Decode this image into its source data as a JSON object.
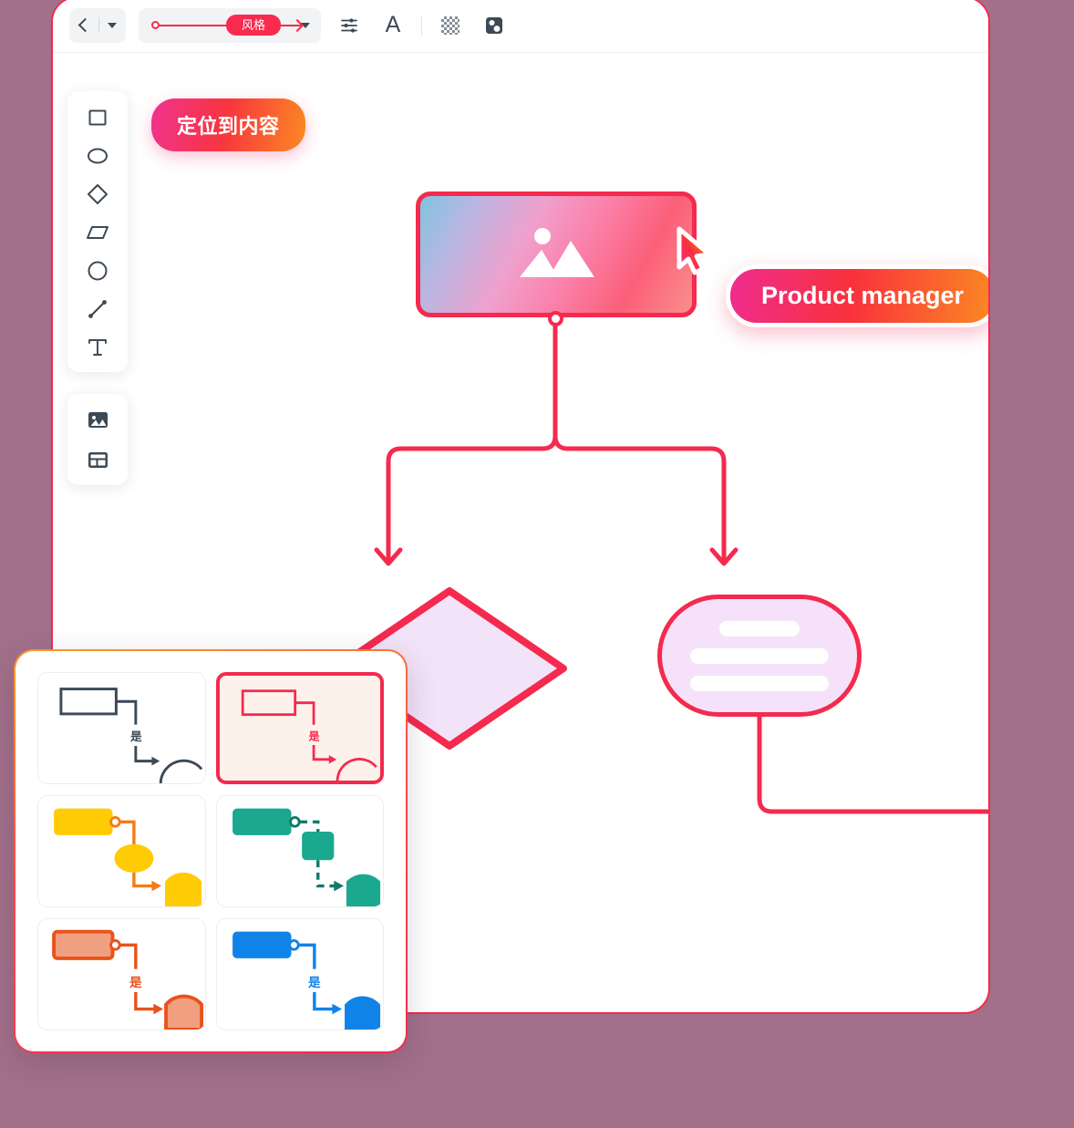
{
  "app": {
    "background_color": "#a2708a",
    "window_border_color": "#f42a4e",
    "accent_color": "#f42a4e"
  },
  "toolbar": {
    "back_button": {
      "name": "back",
      "icon": "chevron-left-icon"
    },
    "back_dropdown": {
      "icon": "caret-down-icon"
    },
    "style_selector": {
      "label": "风格",
      "icon": "connector-style-icon",
      "dropdown_icon": "caret-down-icon"
    },
    "icons": [
      {
        "name": "properties-sliders-icon",
        "label": "属性"
      },
      {
        "name": "font-icon",
        "label": "A"
      },
      {
        "name": "transparency-checker-icon",
        "label": "透明度"
      },
      {
        "name": "fill-shape-icon",
        "label": "填充"
      }
    ]
  },
  "shape_rail": {
    "tools": [
      {
        "name": "rectangle-tool",
        "icon": "square-icon"
      },
      {
        "name": "ellipse-tool",
        "icon": "ellipse-icon"
      },
      {
        "name": "diamond-tool",
        "icon": "diamond-icon"
      },
      {
        "name": "parallelogram-tool",
        "icon": "parallelogram-icon"
      },
      {
        "name": "circle-tool",
        "icon": "circle-icon"
      },
      {
        "name": "line-tool",
        "icon": "line-icon"
      },
      {
        "name": "text-tool",
        "icon": "text-t-icon"
      }
    ]
  },
  "media_rail": {
    "tools": [
      {
        "name": "image-tool",
        "icon": "image-icon"
      },
      {
        "name": "layout-tool",
        "icon": "layout-grid-icon"
      }
    ]
  },
  "canvas": {
    "locate_badge": {
      "label": "定位到内容",
      "gradient_from": "#f0338f",
      "gradient_to": "#fb8a21"
    },
    "role_tag": {
      "label": "Product manager",
      "gradient_from": "#ef2d90",
      "gradient_to": "#fb8a22"
    },
    "image_node": {
      "icon": "image-placeholder-icon",
      "border_color": "#f42a4e"
    },
    "cursor": {
      "icon": "mouse-cursor-icon"
    },
    "node_anchor": {
      "icon": "connection-anchor-icon"
    },
    "diamond_node": {
      "fill": "#f2e3f8",
      "stroke": "#f42a4e"
    },
    "pill_node": {
      "fill": "#f5e2fa",
      "stroke": "#f42a4e",
      "bars": [
        "short",
        "long",
        "long"
      ]
    }
  },
  "style_panel": {
    "swatches": [
      {
        "name": "style-gray",
        "selected": false,
        "stroke": "#3c4956",
        "fill": "none",
        "line": "#3c4956",
        "label": "是",
        "label_color": "#3c4956",
        "dashed": false,
        "anchor": false,
        "mid_shape": "none",
        "background": "#ffffff"
      },
      {
        "name": "style-red",
        "selected": true,
        "stroke": "#f42a4e",
        "fill": "none",
        "line": "#f42a4e",
        "label": "是",
        "label_color": "#f42a4e",
        "dashed": false,
        "anchor": false,
        "mid_shape": "none",
        "background": "#fdf1ec"
      },
      {
        "name": "style-yellow",
        "selected": false,
        "stroke": "none",
        "fill": "#ffcb05",
        "line": "#f57c15",
        "label": "",
        "label_color": "#f57c15",
        "dashed": false,
        "anchor": true,
        "mid_shape": "ellipse",
        "background": "#ffffff"
      },
      {
        "name": "style-teal",
        "selected": false,
        "stroke": "none",
        "fill": "#1aa88f",
        "line": "#14796a",
        "label": "",
        "label_color": "#14796a",
        "dashed": true,
        "anchor": true,
        "mid_shape": "square",
        "background": "#ffffff"
      },
      {
        "name": "style-orange",
        "selected": false,
        "stroke": "#e8531b",
        "fill": "#f0a080",
        "line": "#e8531b",
        "label": "是",
        "label_color": "#e8531b",
        "dashed": false,
        "anchor": true,
        "mid_shape": "none",
        "background": "#ffffff"
      },
      {
        "name": "style-blue",
        "selected": false,
        "stroke": "none",
        "fill": "#1083e8",
        "line": "#1083e8",
        "label": "是",
        "label_color": "#1083e8",
        "dashed": false,
        "anchor": true,
        "mid_shape": "none",
        "background": "#ffffff"
      }
    ]
  }
}
